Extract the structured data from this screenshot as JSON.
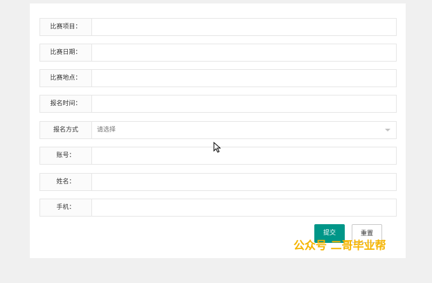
{
  "form": {
    "fields": [
      {
        "label": "比赛项目：",
        "value": ""
      },
      {
        "label": "比赛日期：",
        "value": ""
      },
      {
        "label": "比赛地点：",
        "value": ""
      },
      {
        "label": "报名时间：",
        "value": ""
      },
      {
        "label": "报名方式",
        "value": "请选择",
        "type": "select"
      },
      {
        "label": "账号：",
        "value": ""
      },
      {
        "label": "姓名：",
        "value": ""
      },
      {
        "label": "手机：",
        "value": ""
      }
    ],
    "submit_label": "提交",
    "reset_label": "重置"
  },
  "watermark": "公众号 二哥毕业帮",
  "colors": {
    "submit_bg": "#009688",
    "watermark": "#f5b400"
  },
  "icons": {
    "select_caret": "chevron-down-icon",
    "cursor": "mouse-pointer-icon"
  }
}
